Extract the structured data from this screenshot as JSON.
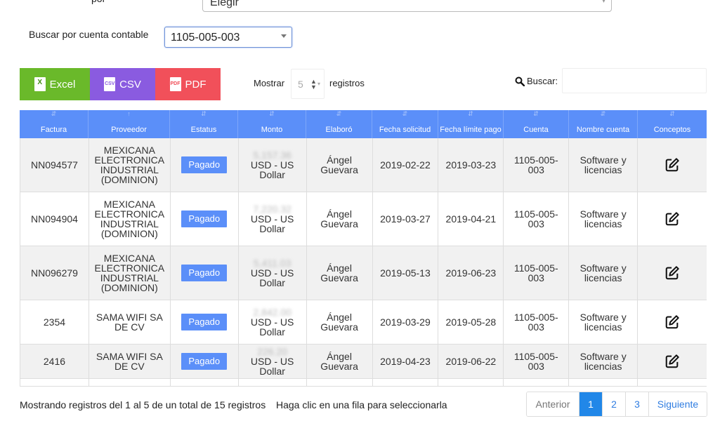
{
  "top_filter": {
    "label": "por",
    "value": "Elegir"
  },
  "account_filter": {
    "label": "Buscar por cuenta contable",
    "value": "1105-005-003"
  },
  "export": {
    "excel": "Excel",
    "csv": "CSV",
    "pdf": "PDF",
    "excel_glyph": "X",
    "csv_glyph": "CSV",
    "pdf_glyph": "PDF"
  },
  "length": {
    "show_label": "Mostrar",
    "value": "5",
    "records_label": "registros"
  },
  "search": {
    "label": "Buscar:",
    "value": ""
  },
  "table": {
    "headers": [
      "Factura",
      "Proveedor",
      "Estatus",
      "Monto",
      "Elaboró",
      "Fecha solicitud",
      "Fecha límite pago",
      "Cuenta",
      "Nombre cuenta",
      "Conceptos"
    ],
    "rows": [
      {
        "factura": "NN094577",
        "proveedor": "MEXICANA ELECTRONICA INDUSTRIAL (DOMINION)",
        "estatus": "Pagado",
        "monto_amount": "5,157.36",
        "monto_currency": "USD - US Dollar",
        "elaboro": "Ángel Guevara",
        "fecha_solicitud": "2019-02-22",
        "fecha_limite": "2019-03-23",
        "cuenta": "1105-005-003",
        "nombre_cuenta": "Software y licencias"
      },
      {
        "factura": "NN094904",
        "proveedor": "MEXICANA ELECTRONICA INDUSTRIAL (DOMINION)",
        "estatus": "Pagado",
        "monto_amount": "7,220.32",
        "monto_currency": "USD - US Dollar",
        "elaboro": "Ángel Guevara",
        "fecha_solicitud": "2019-03-27",
        "fecha_limite": "2019-04-21",
        "cuenta": "1105-005-003",
        "nombre_cuenta": "Software y licencias"
      },
      {
        "factura": "NN096279",
        "proveedor": "MEXICANA ELECTRONICA INDUSTRIAL (DOMINION)",
        "estatus": "Pagado",
        "monto_amount": "5,411.03",
        "monto_currency": "USD - US Dollar",
        "elaboro": "Ángel Guevara",
        "fecha_solicitud": "2019-05-13",
        "fecha_limite": "2019-06-23",
        "cuenta": "1105-005-003",
        "nombre_cuenta": "Software y licencias"
      },
      {
        "factura": "2354",
        "proveedor": "SAMA WIFI SA DE CV",
        "estatus": "Pagado",
        "monto_amount": "2,842.00",
        "monto_currency": "USD - US Dollar",
        "elaboro": "Ángel Guevara",
        "fecha_solicitud": "2019-03-29",
        "fecha_limite": "2019-05-28",
        "cuenta": "1105-005-003",
        "nombre_cuenta": "Software y licencias"
      },
      {
        "factura": "2416",
        "proveedor": "SAMA WIFI SA DE CV",
        "estatus": "Pagado",
        "monto_amount": "226.20",
        "monto_currency": "USD - US Dollar",
        "elaboro": "Ángel Guevara",
        "fecha_solicitud": "2019-04-23",
        "fecha_limite": "2019-06-22",
        "cuenta": "1105-005-003",
        "nombre_cuenta": "Software y licencias"
      }
    ],
    "edit_icon": "edit-icon"
  },
  "footer": {
    "info": "Mostrando registros del 1 al 5 de un total de 15 registros",
    "hint": "Haga clic en una fila para seleccionarla"
  },
  "pagination": {
    "prev": "Anterior",
    "pages": [
      "1",
      "2",
      "3"
    ],
    "active_page": "1",
    "next": "Siguiente"
  },
  "colors": {
    "header": "#5b8ff9",
    "excel": "#6ab92a",
    "csv": "#8a5be0",
    "pdf": "#f1505a",
    "active_page": "#2187e8"
  }
}
